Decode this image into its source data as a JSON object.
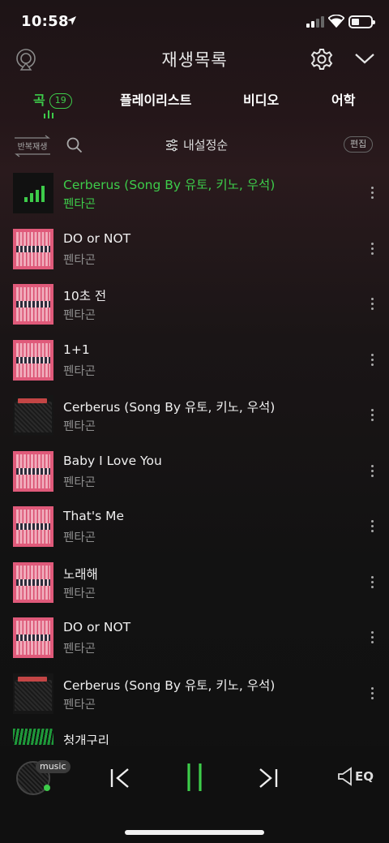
{
  "status_bar": {
    "time": "10:58"
  },
  "header": {
    "title": "재생목록"
  },
  "tabs": [
    {
      "label": "곡",
      "count": "19"
    },
    {
      "label": "플레이리스트"
    },
    {
      "label": "비디오"
    },
    {
      "label": "어학"
    }
  ],
  "toolbar": {
    "repeat_label": "반복재생",
    "sort_label": "내설정순",
    "edit_label": "편집"
  },
  "songs": [
    {
      "title": "Cerberus (Song By 유토, 키노, 우석)",
      "artist": "펜타곤",
      "art": "now-playing",
      "playing": true
    },
    {
      "title": "DO or NOT",
      "artist": "펜타곤",
      "art": "pink"
    },
    {
      "title": "10초 전",
      "artist": "펜타곤",
      "art": "pink"
    },
    {
      "title": "1+1",
      "artist": "펜타곤",
      "art": "pink"
    },
    {
      "title": "Cerberus (Song By 유토, 키노, 우석)",
      "artist": "펜타곤",
      "art": "dark"
    },
    {
      "title": "Baby I Love You",
      "artist": "펜타곤",
      "art": "pink"
    },
    {
      "title": "That's Me",
      "artist": "펜타곤",
      "art": "pink"
    },
    {
      "title": "노래해",
      "artist": "펜타곤",
      "art": "pink"
    },
    {
      "title": "DO or NOT",
      "artist": "펜타곤",
      "art": "pink"
    },
    {
      "title": "Cerberus (Song By 유토, 키노, 우석)",
      "artist": "펜타곤",
      "art": "dark"
    },
    {
      "title": "청개구리",
      "artist": "",
      "art": "green"
    }
  ],
  "player": {
    "badge": "music",
    "eq_label": "EQ"
  },
  "colors": {
    "accent": "#3dcc4a",
    "secondary_text": "#8e8e8e"
  }
}
